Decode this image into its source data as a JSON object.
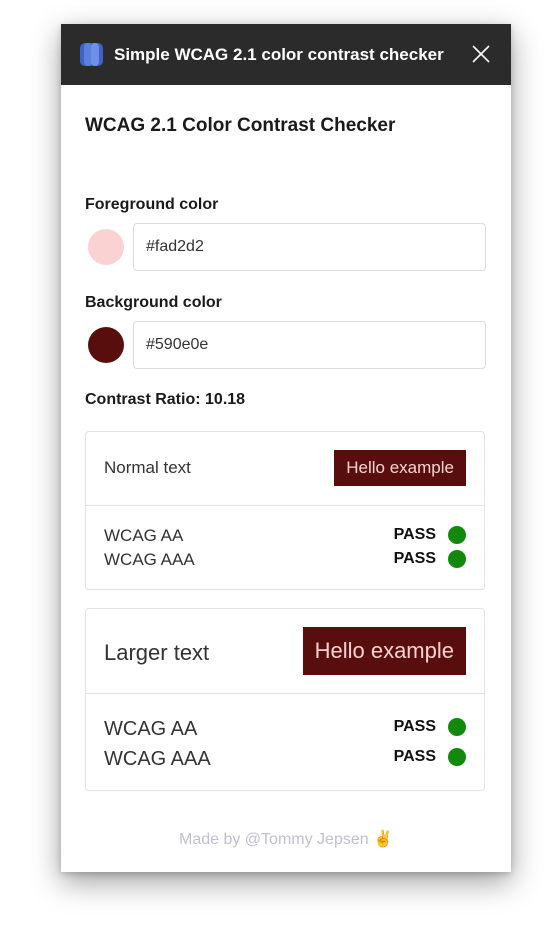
{
  "window": {
    "title": "Simple WCAG 2.1 color contrast checker",
    "app_icon": "app-logo-icon",
    "close_icon": "close-icon"
  },
  "page": {
    "heading": "WCAG 2.1 Color Contrast Checker"
  },
  "foreground": {
    "label": "Foreground color",
    "value": "#fad2d2",
    "swatch_color": "#fad2d2"
  },
  "background": {
    "label": "Background color",
    "value": "#590e0e",
    "swatch_color": "#590e0e"
  },
  "contrast": {
    "label": "Contrast Ratio:",
    "value": "10.18"
  },
  "normal_text": {
    "label": "Normal text",
    "example": "Hello example",
    "checks": [
      {
        "level": "WCAG AA",
        "result": "PASS"
      },
      {
        "level": "WCAG AAA",
        "result": "PASS"
      }
    ]
  },
  "larger_text": {
    "label": "Larger text",
    "example": "Hello example",
    "checks": [
      {
        "level": "WCAG AA",
        "result": "PASS"
      },
      {
        "level": "WCAG AAA",
        "result": "PASS"
      }
    ]
  },
  "colors": {
    "titlebar": "#2b2b2b",
    "pass": "#118a0b",
    "footer_text": "#c0c0cc"
  },
  "footer": {
    "text": "Made by @Tommy Jepsen ✌️"
  }
}
